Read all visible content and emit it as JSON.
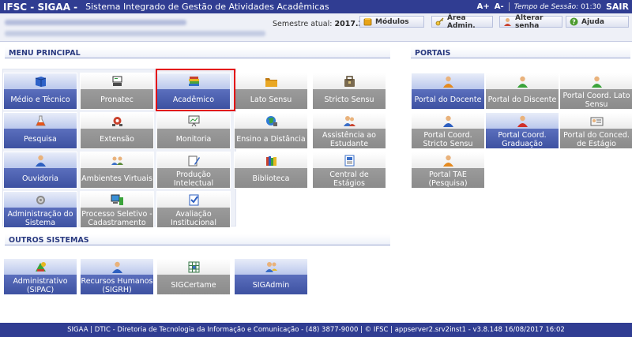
{
  "header": {
    "brand": "IFSC - SIGAA -",
    "system_name": "Sistema Integrado de Gestão de Atividades Acadêmicas",
    "font_increase": "A+",
    "font_decrease": "A-",
    "session_label": "Tempo de Sessão:",
    "session_time": "01:30",
    "logout": "SAIR"
  },
  "userbar": {
    "semester_label": "Semestre atual:",
    "semester_value": "2017.2",
    "buttons": {
      "modulos": "Módulos",
      "area_admin": "Área Admin.",
      "alterar_senha": "Alterar senha",
      "ajuda": "Ajuda"
    }
  },
  "menu_principal": {
    "title": "MENU PRINCIPAL",
    "tiles": [
      {
        "label": "Médio e Técnico",
        "icon": "book-icon"
      },
      {
        "label": "Pronatec",
        "icon": "classroom-icon"
      },
      {
        "label": "Acadêmico",
        "icon": "books-stack-icon"
      },
      {
        "label": "Lato Sensu",
        "icon": "folder-icon"
      },
      {
        "label": "Stricto Sensu",
        "icon": "bag-icon"
      },
      {
        "label": "Pesquisa",
        "icon": "flask-icon"
      },
      {
        "label": "Extensão",
        "icon": "network-icon"
      },
      {
        "label": "Monitoria",
        "icon": "presentation-icon"
      },
      {
        "label": "Ensino a Distância",
        "icon": "globe-icon"
      },
      {
        "label": "Assistência ao Estudante",
        "icon": "users-icon"
      },
      {
        "label": "Ouvidoria",
        "icon": "user-icon"
      },
      {
        "label": "Ambientes Virtuais",
        "icon": "virtual-users-icon"
      },
      {
        "label": "Produção Intelectual",
        "icon": "pen-icon"
      },
      {
        "label": "Biblioteca",
        "icon": "library-icon"
      },
      {
        "label": "Central de Estágios",
        "icon": "document-icon"
      },
      {
        "label": "Administração do Sistema",
        "icon": "gear-icon"
      },
      {
        "label": "Processo Seletivo - Cadastramento",
        "icon": "computer-icon"
      },
      {
        "label": "Avaliação Institucional",
        "icon": "checklist-icon"
      }
    ]
  },
  "outros_sistemas": {
    "title": "OUTROS SISTEMAS",
    "tiles": [
      {
        "label": "Administrativo (SIPAC)",
        "icon": "admin-icon"
      },
      {
        "label": "Recursos Humanos (SIGRH)",
        "icon": "user-icon"
      },
      {
        "label": "SIGCertame",
        "icon": "grid-icon"
      },
      {
        "label": "SIGAdmin",
        "icon": "admin-users-icon"
      }
    ]
  },
  "portais": {
    "title": "PORTAIS",
    "tiles": [
      {
        "label": "Portal do Docente",
        "icon": "user-orange-icon"
      },
      {
        "label": "Portal do Discente",
        "icon": "user-green-icon"
      },
      {
        "label": "Portal Coord. Lato Sensu",
        "icon": "user-green-icon"
      },
      {
        "label": "Portal Coord. Stricto Sensu",
        "icon": "user-blue-icon"
      },
      {
        "label": "Portal Coord. Graduação",
        "icon": "user-red-icon"
      },
      {
        "label": "Portal do Conced. de Estágio",
        "icon": "id-card-icon"
      },
      {
        "label": "Portal TAE (Pesquisa)",
        "icon": "user-orange-icon"
      }
    ]
  },
  "footer": {
    "text": "SIGAA | DTIC - Diretoria de Tecnologia da Informação e Comunicação - (48) 3877-9000 | © IFSC | appserver2.srv2inst1 - v3.8.148 16/08/2017 16:02"
  },
  "colors": {
    "header_bg": "#303d92",
    "tile_active": "#3b4f9f",
    "tile_inactive": "#8a8a8a",
    "highlight": "#e30000"
  }
}
